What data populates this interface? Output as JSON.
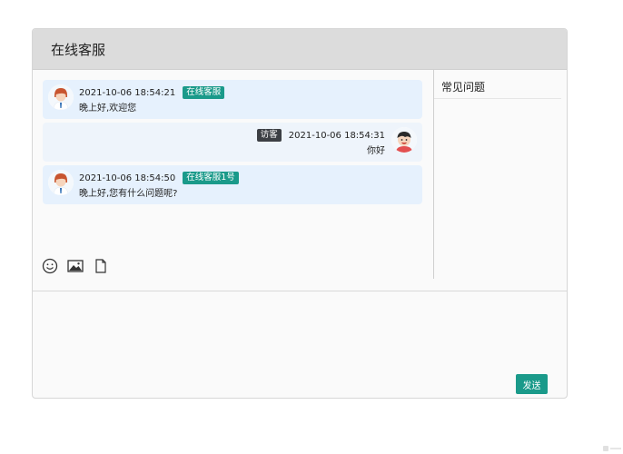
{
  "header": {
    "title": "在线客服"
  },
  "faq": {
    "title": "常见问题"
  },
  "messages": [
    {
      "sender": "service",
      "time": "2021-10-06 18:54:21",
      "badge": "在线客服",
      "text": "晚上好,欢迎您"
    },
    {
      "sender": "visitor",
      "time": "2021-10-06 18:54:31",
      "badge": "访客",
      "text": "你好"
    },
    {
      "sender": "service",
      "time": "2021-10-06 18:54:50",
      "badge": "在线客服1号",
      "text": "晚上好,您有什么问题呢?"
    }
  ],
  "toolbar": {
    "icons": [
      "emoji-icon",
      "image-icon",
      "file-icon"
    ]
  },
  "composer": {
    "send_label": "发送"
  },
  "colors": {
    "accent": "#1a9a8a",
    "service_bg": "#e6f1fd",
    "visitor_bg": "#eef4fb"
  }
}
